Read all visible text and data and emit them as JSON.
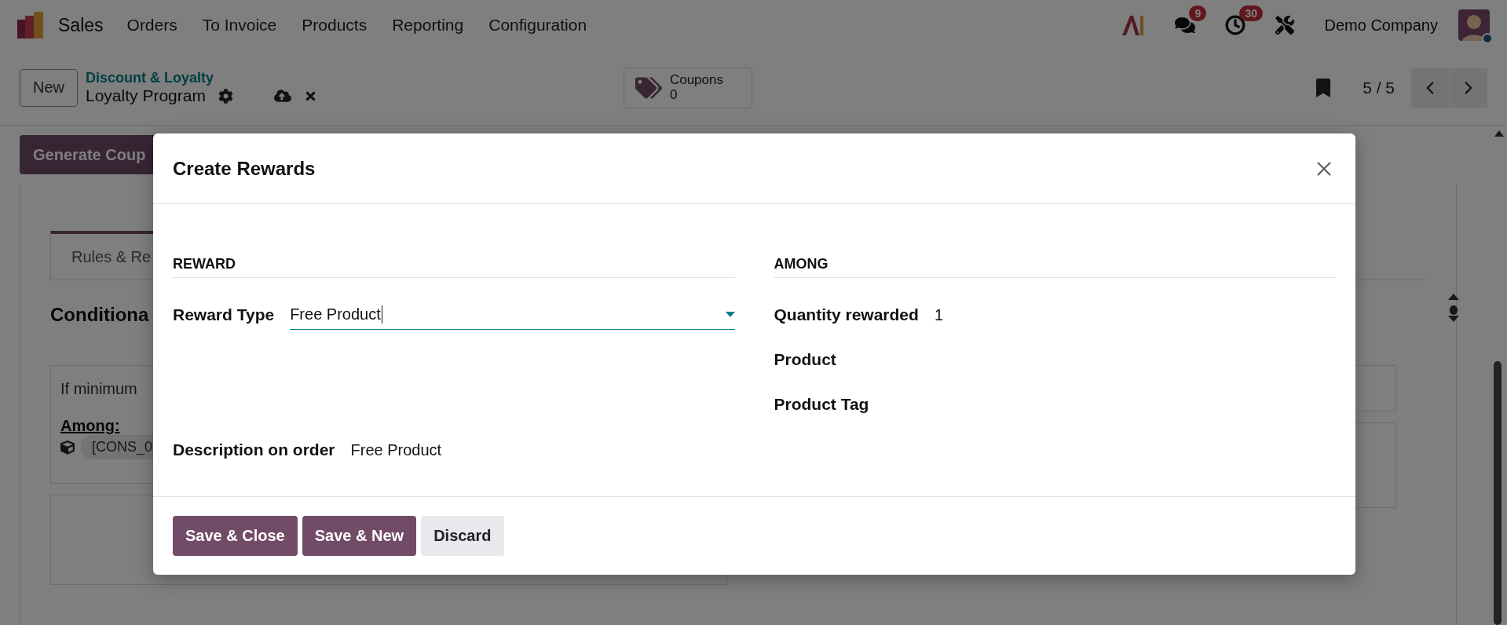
{
  "navbar": {
    "app": "Sales",
    "menu": [
      "Orders",
      "To Invoice",
      "Products",
      "Reporting",
      "Configuration"
    ],
    "messages_badge": "9",
    "activities_badge": "30",
    "company": "Demo Company"
  },
  "control_panel": {
    "new_button": "New",
    "breadcrumb": "Discount & Loyalty",
    "record_title": "Loyalty Program",
    "stat_button": {
      "label": "Coupons",
      "value": "0"
    },
    "pager": "5 / 5"
  },
  "form": {
    "action_button": "Generate Coup",
    "tabs": [
      {
        "label": "Rules & Re",
        "selected": true
      }
    ],
    "section_title": "Conditiona",
    "rule_card": {
      "text": "If minimum",
      "among_label": "Among:",
      "tag": "[CONS_0"
    }
  },
  "dialog": {
    "title": "Create Rewards",
    "left": {
      "heading": "REWARD",
      "fields": [
        {
          "label": "Reward Type",
          "value": "Free Product",
          "kind": "select"
        },
        {
          "label": "Description on order",
          "value": "Free Product",
          "kind": "text"
        }
      ]
    },
    "right": {
      "heading": "AMONG",
      "fields": [
        {
          "label": "Quantity rewarded",
          "value": "1"
        },
        {
          "label": "Product"
        },
        {
          "label": "Product Tag"
        }
      ]
    },
    "buttons": [
      {
        "label": "Save & Close",
        "kind": "primary"
      },
      {
        "label": "Save & New",
        "kind": "primary"
      },
      {
        "label": "Discard",
        "kind": "secondary"
      }
    ]
  }
}
